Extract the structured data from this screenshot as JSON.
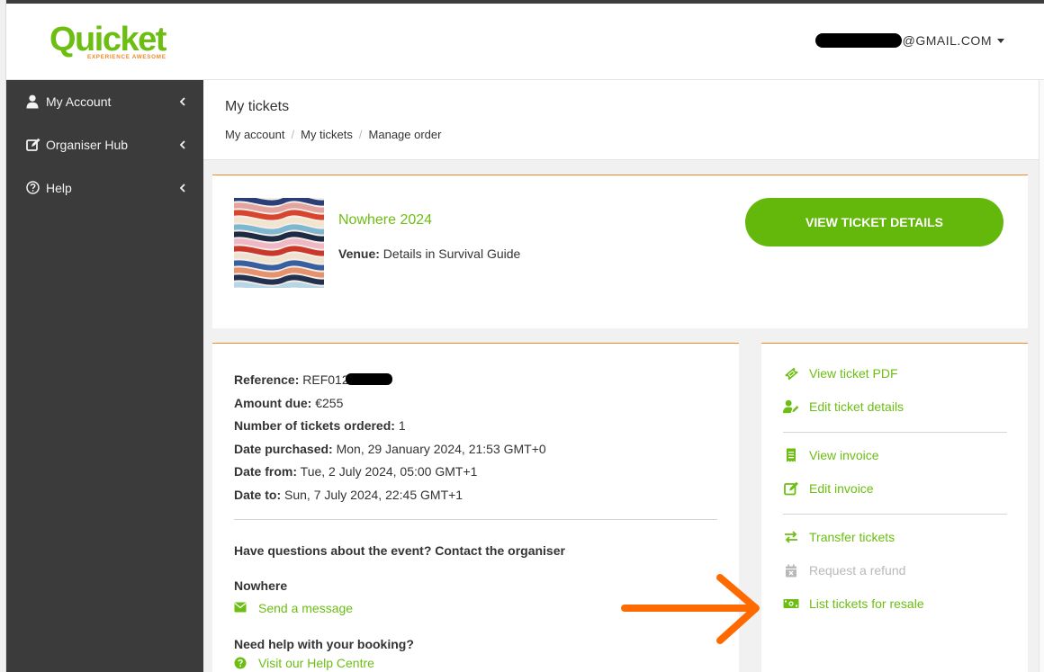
{
  "header": {
    "logo_text": "Quicket",
    "logo_tagline": "EXPERIENCE AWESOME",
    "user_email": "@GMAIL.COM"
  },
  "sidebar": {
    "items": [
      {
        "label": "My Account",
        "icon": "user-icon"
      },
      {
        "label": "Organiser Hub",
        "icon": "edit-icon"
      },
      {
        "label": "Help",
        "icon": "question-circle-icon"
      }
    ]
  },
  "page": {
    "title": "My tickets",
    "breadcrumb": [
      "My account",
      "My tickets",
      "Manage order"
    ]
  },
  "event": {
    "name": "Nowhere 2024",
    "venue_label": "Venue:",
    "venue_value": "Details in Survival Guide",
    "view_button": "VIEW TICKET DETAILS"
  },
  "order": {
    "reference_label": "Reference:",
    "reference_value": "REF012",
    "amount_label": "Amount due:",
    "amount_value": "€255",
    "tickets_label": "Number of tickets ordered:",
    "tickets_value": "1",
    "purchased_label": "Date purchased:",
    "purchased_value": "Mon, 29 January 2024, 21:53 GMT+0",
    "from_label": "Date from:",
    "from_value": "Tue, 2 July 2024, 05:00 GMT+1",
    "to_label": "Date to:",
    "to_value": "Sun, 7 July 2024, 22:45 GMT+1",
    "contact_question": "Have questions about the event? Contact the organiser",
    "organiser_name": "Nowhere",
    "send_message": "Send a message",
    "help_question": "Need help with your booking?",
    "help_centre": "Visit our Help Centre"
  },
  "actions": {
    "view_pdf": "View ticket PDF",
    "edit_details": "Edit ticket details",
    "view_invoice": "View invoice",
    "edit_invoice": "Edit invoice",
    "transfer": "Transfer tickets",
    "refund": "Request a refund",
    "resale": "List tickets for resale"
  },
  "colors": {
    "brand_green": "#64b80b",
    "link_green": "#6cbe12",
    "accent_orange": "#f08a24",
    "sidebar_bg": "#3b3b3b",
    "annotation_arrow": "#ff6a00"
  }
}
